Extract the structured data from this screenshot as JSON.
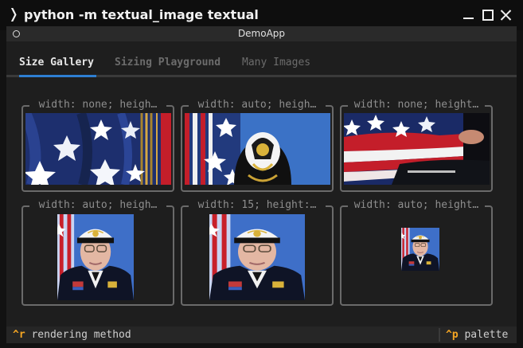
{
  "window": {
    "title": "python -m textual_image textual",
    "prompt_glyph": "❭"
  },
  "app": {
    "title": "DemoApp"
  },
  "tabs": [
    {
      "label": "Size Gallery",
      "active": true
    },
    {
      "label": "Sizing Playground",
      "active": false
    },
    {
      "label": "Many Images",
      "active": false
    }
  ],
  "gallery": [
    {
      "label": "width: none; heigh…",
      "image": "flag-stars-closeup"
    },
    {
      "label": "width: auto; heigh…",
      "image": "flag-with-insignia-cap"
    },
    {
      "label": "width: none; height…",
      "image": "flag-stripes-closeup"
    },
    {
      "label": "width: auto; heigh…",
      "image": "portrait-officer"
    },
    {
      "label": "width: 15; height:…",
      "image": "portrait-officer"
    },
    {
      "label": "width: auto; height…",
      "image": "portrait-officer-small"
    }
  ],
  "footer": {
    "render_key": "^r",
    "render_label": "rendering method",
    "palette_key": "^p",
    "palette_label": "palette"
  },
  "colors": {
    "accent": "#2e7fd2",
    "key": "#f5a623",
    "background": "#1e1e1e"
  }
}
